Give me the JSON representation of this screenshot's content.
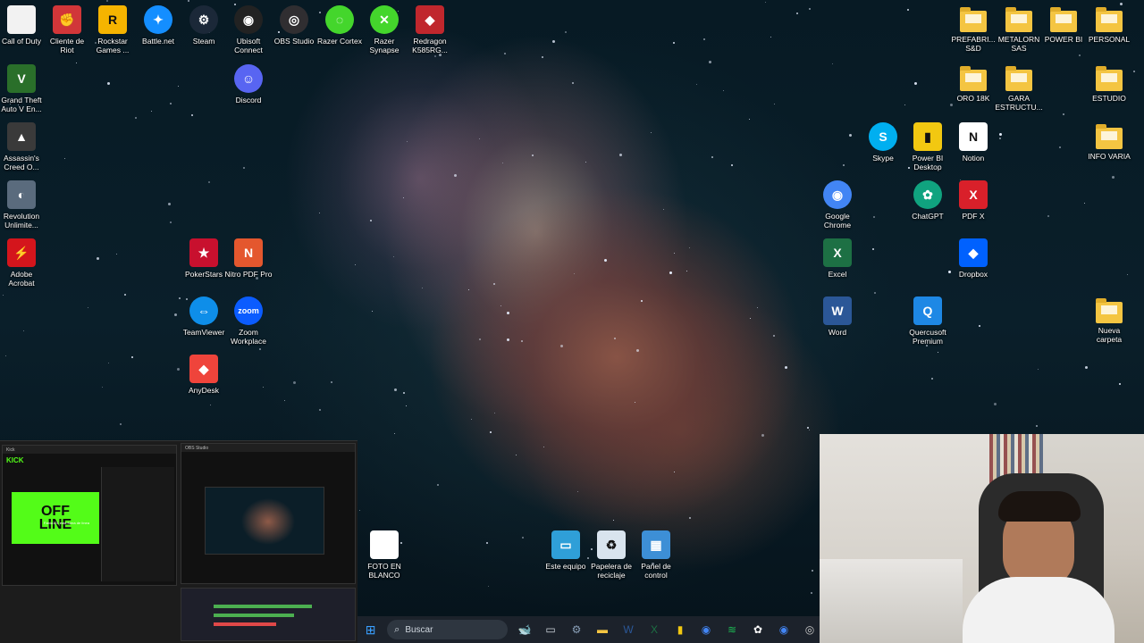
{
  "colors": {
    "accent": "#0a66c2",
    "folder": "#f4c542",
    "kick_green": "#53fc18"
  },
  "desktop_icons": [
    {
      "id": "call-of-duty",
      "label": "Call of Duty",
      "icon": "file-icon",
      "bg": "#f2f2f2"
    },
    {
      "id": "cliente-de-riot",
      "label": "Cliente de\nRiot",
      "icon": "riot-icon",
      "bg": "#d13639"
    },
    {
      "id": "rockstar",
      "label": "Rockstar\nGames ...",
      "icon": "rockstar-icon",
      "bg": "#f5b400"
    },
    {
      "id": "battlenet",
      "label": "Battle.net",
      "icon": "battlenet-icon",
      "bg": "#148eff"
    },
    {
      "id": "steam",
      "label": "Steam",
      "icon": "steam-icon",
      "bg": "#1b2838"
    },
    {
      "id": "ubisoft",
      "label": "Ubisoft\nConnect",
      "icon": "ubisoft-icon",
      "bg": "#222"
    },
    {
      "id": "obs",
      "label": "OBS Studio",
      "icon": "obs-icon",
      "bg": "#302e31"
    },
    {
      "id": "razer-cortex",
      "label": "Razer Cortex",
      "icon": "razer-cortex-icon",
      "bg": "#44d62c"
    },
    {
      "id": "razer-synapse",
      "label": "Razer\nSynapse",
      "icon": "razer-synapse-icon",
      "bg": "#44d62c"
    },
    {
      "id": "redragon",
      "label": "Redragon\nK585RG...",
      "icon": "redragon-icon",
      "bg": "#c0272d"
    },
    {
      "id": "gta",
      "label": "Grand Theft\nAuto V En...",
      "icon": "gta-icon",
      "bg": "#2a6f2a"
    },
    {
      "id": "discord",
      "label": "Discord",
      "icon": "discord-icon",
      "bg": "#5865f2"
    },
    {
      "id": "assassins",
      "label": "Assassin's\nCreed O...",
      "icon": "assassins-icon",
      "bg": "#3a3a3a"
    },
    {
      "id": "revolution",
      "label": "Revolution\nUnlimite...",
      "icon": "revolution-icon",
      "bg": "#5a6b7d"
    },
    {
      "id": "acrobat",
      "label": "Adobe\nAcrobat",
      "icon": "acrobat-icon",
      "bg": "#d4151c"
    },
    {
      "id": "pokerstars",
      "label": "PokerStars",
      "icon": "pokerstars-icon",
      "bg": "#c8102e"
    },
    {
      "id": "nitro",
      "label": "Nitro PDF Pro",
      "icon": "nitro-icon",
      "bg": "#e4572e"
    },
    {
      "id": "teamviewer",
      "label": "TeamViewer",
      "icon": "teamviewer-icon",
      "bg": "#0e8ee9"
    },
    {
      "id": "zoom",
      "label": "Zoom\nWorkplace",
      "icon": "zoom-icon",
      "bg": "#0b5cff"
    },
    {
      "id": "anydesk",
      "label": "AnyDesk",
      "icon": "anydesk-icon",
      "bg": "#ef443b"
    },
    {
      "id": "foto-blanco",
      "label": "FOTO EN\nBLANCO",
      "icon": "blank-photo-icon",
      "bg": "#ffffff"
    },
    {
      "id": "este-equipo",
      "label": "Este equipo",
      "icon": "computer-icon",
      "bg": "#2f9fd8"
    },
    {
      "id": "papelera",
      "label": "Papelera de\nreciclaje",
      "icon": "recycle-bin-icon",
      "bg": "#d9e4ee"
    },
    {
      "id": "panel-control",
      "label": "Panel de\ncontrol",
      "icon": "control-panel-icon",
      "bg": "#3d8fd6"
    },
    {
      "id": "prefabri",
      "label": "PREFABRI...\nS&D",
      "icon": "folder-icon",
      "bg": "#f4c542"
    },
    {
      "id": "metalorn",
      "label": "METALORN\nSAS",
      "icon": "folder-icon",
      "bg": "#f4c542"
    },
    {
      "id": "powerbi-folder",
      "label": "POWER BI",
      "icon": "folder-icon",
      "bg": "#f4c542"
    },
    {
      "id": "personal",
      "label": "PERSONAL",
      "icon": "folder-icon",
      "bg": "#f4c542"
    },
    {
      "id": "oro",
      "label": "ORO 18K",
      "icon": "folder-icon",
      "bg": "#f4c542"
    },
    {
      "id": "gara",
      "label": "GARA\nESTRUCTU...",
      "icon": "folder-icon",
      "bg": "#f4c542"
    },
    {
      "id": "estudio",
      "label": "ESTUDIO",
      "icon": "folder-icon",
      "bg": "#f4c542"
    },
    {
      "id": "skype",
      "label": "Skype",
      "icon": "skype-icon",
      "bg": "#00aff0"
    },
    {
      "id": "powerbi",
      "label": "Power BI\nDesktop",
      "icon": "powerbi-icon",
      "bg": "#f2c811"
    },
    {
      "id": "notion",
      "label": "Notion",
      "icon": "notion-icon",
      "bg": "#ffffff"
    },
    {
      "id": "info-varia",
      "label": "INFO VARIA",
      "icon": "folder-icon",
      "bg": "#f4c542"
    },
    {
      "id": "chrome",
      "label": "Google\nChrome",
      "icon": "chrome-icon",
      "bg": "#4285f4"
    },
    {
      "id": "chatgpt",
      "label": "ChatGPT",
      "icon": "chatgpt-icon",
      "bg": "#10a37f"
    },
    {
      "id": "pdfx",
      "label": "PDF X",
      "icon": "pdfx-icon",
      "bg": "#d9202a"
    },
    {
      "id": "excel",
      "label": "Excel",
      "icon": "excel-icon",
      "bg": "#1d7044"
    },
    {
      "id": "dropbox",
      "label": "Dropbox",
      "icon": "dropbox-icon",
      "bg": "#0061fe"
    },
    {
      "id": "word",
      "label": "Word",
      "icon": "word-icon",
      "bg": "#2b5797"
    },
    {
      "id": "quercusoft",
      "label": "Quercusoft\nPremium",
      "icon": "quercusoft-icon",
      "bg": "#1e88e5"
    },
    {
      "id": "nueva-carpeta",
      "label": "Nueva\ncarpeta",
      "icon": "folder-icon",
      "bg": "#f4c542"
    }
  ],
  "icon_glyphs": {
    "call-of-duty": "",
    "cliente-de-riot": "✊",
    "rockstar": "R",
    "battlenet": "✦",
    "steam": "⚙",
    "ubisoft": "◉",
    "obs": "◎",
    "razer-cortex": "◌",
    "razer-synapse": "✕",
    "redragon": "◆",
    "gta": "V",
    "discord": "☺",
    "assassins": "▲",
    "revolution": "◐",
    "acrobat": "⚡",
    "pokerstars": "★",
    "nitro": "N",
    "teamviewer": "⇔",
    "zoom": "zoom",
    "anydesk": "◆",
    "foto-blanco": "",
    "este-equipo": "▭",
    "papelera": "♻",
    "panel-control": "▦",
    "skype": "S",
    "powerbi": "▮",
    "notion": "N",
    "chrome": "◉",
    "chatgpt": "✿",
    "pdfx": "X",
    "excel": "X",
    "dropbox": "◆",
    "word": "W",
    "quercusoft": "Q"
  },
  "taskbar": {
    "search_placeholder": "Buscar",
    "items": [
      {
        "id": "start",
        "icon": "windows-icon",
        "glyph": "⊞"
      },
      {
        "id": "whale",
        "icon": "whale-icon",
        "glyph": "🐋"
      },
      {
        "id": "task-view",
        "icon": "task-view-icon",
        "glyph": "▭"
      },
      {
        "id": "settings",
        "icon": "gear-icon",
        "glyph": "⚙"
      },
      {
        "id": "explorer",
        "icon": "folder-icon",
        "glyph": "▬"
      },
      {
        "id": "word",
        "icon": "word-icon",
        "glyph": "W"
      },
      {
        "id": "excel",
        "icon": "excel-icon",
        "glyph": "X"
      },
      {
        "id": "powerbi",
        "icon": "powerbi-icon",
        "glyph": "▮"
      },
      {
        "id": "chrome",
        "icon": "chrome-icon",
        "glyph": "◉"
      },
      {
        "id": "spotify",
        "icon": "spotify-icon",
        "glyph": "≋"
      },
      {
        "id": "chatgpt",
        "icon": "chatgpt-icon",
        "glyph": "✿"
      },
      {
        "id": "chrome-profile",
        "icon": "chrome-icon",
        "glyph": "◉"
      },
      {
        "id": "obs",
        "icon": "obs-icon",
        "glyph": "◎"
      }
    ]
  },
  "preview": {
    "kick_logo": "KICK",
    "offline_text": "OFF\nLINE",
    "offline_caption": "Fabio101 está fuera de línea",
    "obs_title": "OBS Studio"
  }
}
